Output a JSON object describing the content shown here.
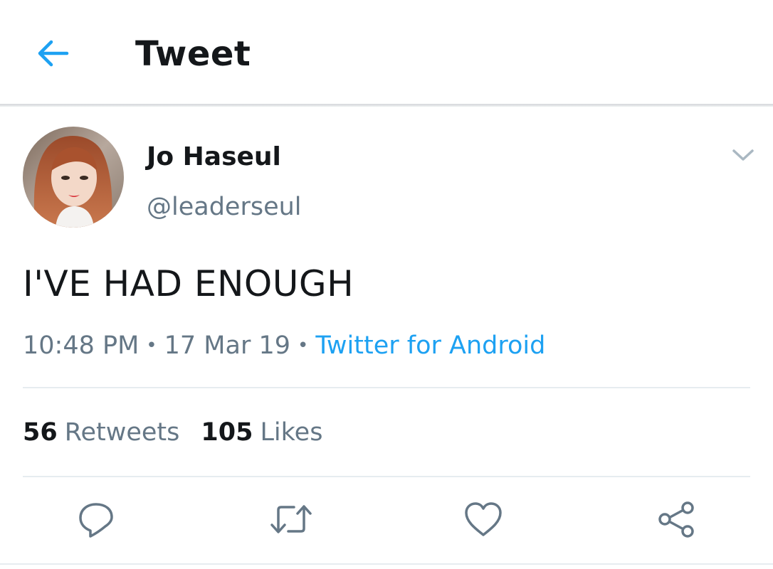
{
  "header": {
    "back_icon": "arrow-left-icon",
    "title": "Tweet"
  },
  "tweet": {
    "author": {
      "name": "Jo Haseul",
      "handle": "@leaderseul"
    },
    "text": "I'VE HAD ENOUGH",
    "meta": {
      "time": "10:48 PM",
      "separator": "•",
      "date": "17 Mar 19",
      "source": "Twitter for Android"
    },
    "stats": {
      "retweets_count": "56",
      "retweets_label": "Retweets",
      "likes_count": "105",
      "likes_label": "Likes"
    }
  },
  "actions": [
    "reply-icon",
    "retweet-icon",
    "like-icon",
    "share-icon"
  ],
  "colors": {
    "accent": "#1da1f2",
    "text": "#14171a",
    "secondary": "#657786",
    "icon": "#657786",
    "divider": "#e6ecf0"
  }
}
